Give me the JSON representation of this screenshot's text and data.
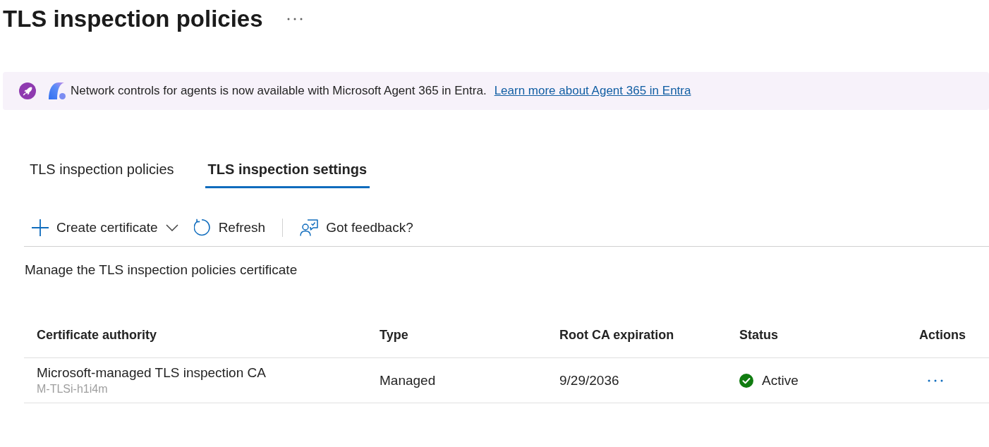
{
  "page": {
    "title": "TLS inspection policies"
  },
  "banner": {
    "message": "Network controls for agents is now available with Microsoft Agent 365 in Entra.",
    "link": "Learn more about Agent 365 in Entra"
  },
  "tabs": [
    {
      "label": "TLS inspection policies",
      "selected": false
    },
    {
      "label": "TLS inspection settings",
      "selected": true
    }
  ],
  "toolbar": [
    {
      "kind": "add-menu",
      "label": "Create certificate"
    },
    {
      "kind": "refresh",
      "label": "Refresh"
    },
    {
      "kind": "separator"
    },
    {
      "kind": "feedback",
      "label": "Got feedback?"
    }
  ],
  "description": "Manage the TLS inspection policies certificate",
  "table": {
    "columns": [
      "Certificate authority",
      "Type",
      "Root CA expiration",
      "Status",
      "Actions"
    ],
    "rows": [
      {
        "name": "Microsoft-managed TLS inspection CA",
        "subtitle": "M-TLSi-h1i4m",
        "type": "Managed",
        "expiration": "9/29/2036",
        "status": {
          "kind": "success",
          "label": "Active"
        }
      }
    ]
  }
}
